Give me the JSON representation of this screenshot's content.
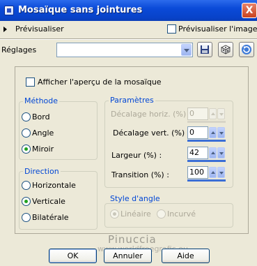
{
  "window": {
    "title": "Mosaïque sans jointures",
    "close_glyph": "X"
  },
  "preview": {
    "expand_label": "Prévisualiser",
    "preview_image_label": "Prévisualiser l'image"
  },
  "presets": {
    "label": "Réglages",
    "value": ""
  },
  "tiling_preview_label": "Afficher l'aperçu de la mosaïque",
  "method": {
    "title": "Méthode",
    "options": [
      "Bord",
      "Angle",
      "Miroir"
    ],
    "selected": "Miroir"
  },
  "direction": {
    "title": "Direction",
    "options": [
      "Horizontale",
      "Verticale",
      "Bilatérale"
    ],
    "selected": "Verticale"
  },
  "params": {
    "title": "Paramètres",
    "fields": [
      {
        "label": "Décalage horiz. (%) :",
        "value": "0",
        "enabled": false
      },
      {
        "label": "Décalage vert. (%) :",
        "value": "0",
        "enabled": true
      },
      {
        "label": "Largeur (%) :",
        "value": "42",
        "enabled": true
      },
      {
        "label": "Transition (%) :",
        "value": "100",
        "enabled": true
      }
    ]
  },
  "corner_style": {
    "title": "Style d'angle",
    "options": [
      "Linéaire",
      "Incurvé"
    ],
    "selected": "Linéaire",
    "enabled": false
  },
  "buttons": {
    "ok": "OK",
    "cancel": "Annuler",
    "help": "Aide"
  },
  "watermark": {
    "line1": "Pinuccia",
    "line2": "www.worldfreegrafic.eu"
  }
}
